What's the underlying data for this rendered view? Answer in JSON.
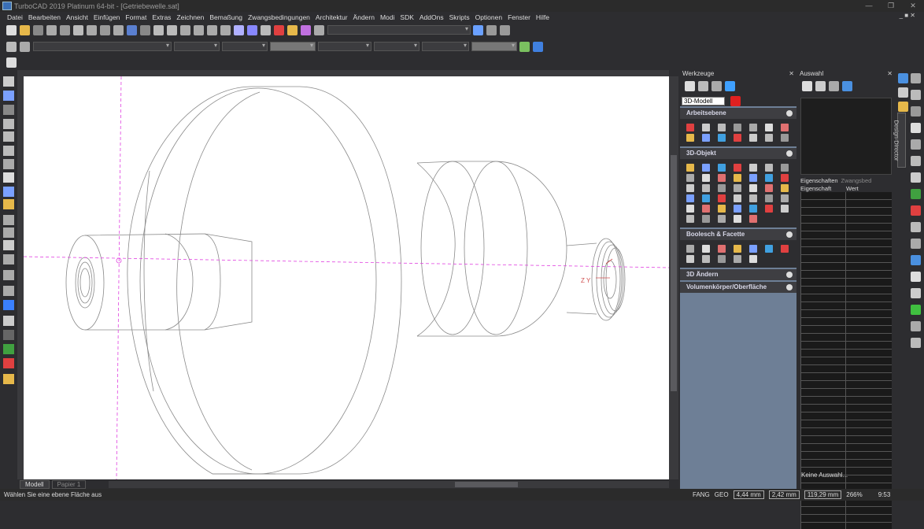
{
  "window": {
    "title": "TurboCAD 2019 Platinum 64-bit - [Getriebewelle.sat]",
    "minimize": "—",
    "restore": "❐",
    "close": "✕",
    "mdi_controls": "_ ■ ✕"
  },
  "menu": [
    "Datei",
    "Bearbeiten",
    "Ansicht",
    "Einfügen",
    "Format",
    "Extras",
    "Zeichnen",
    "Bemaßung",
    "Zwangsbedingungen",
    "Architektur",
    "Ändern",
    "Modi",
    "SDK",
    "AddOns",
    "Skripts",
    "Optionen",
    "Fenster",
    "Hilfe"
  ],
  "viewport": {
    "axis_label": "Z Y"
  },
  "tabs": {
    "model": "Modell",
    "paper": "Papier 1"
  },
  "status": {
    "message": "Wählen Sie eine ebene Fläche aus",
    "snap1": "FANG",
    "snap2": "GEO",
    "field1": "4,44 mm",
    "field2": "2,42 mm",
    "field3": "119,29 mm",
    "zoom": "266%",
    "time": "9:53"
  },
  "werkzeuge": {
    "title": "Werkzeuge",
    "mode_select": "3D-Modell",
    "sections": [
      {
        "label": "Arbeitsebene",
        "icons": 14
      },
      {
        "label": "3D-Objekt",
        "icons": 40
      },
      {
        "label": "Boolesch & Facette",
        "icons": 12
      },
      {
        "label": "3D Ändern",
        "icons": 0
      },
      {
        "label": "Volumenkörper/Oberfläche",
        "icons": 0
      }
    ]
  },
  "auswahl": {
    "title": "Auswahl",
    "tab_properties": "Eigenschaften",
    "tab_constraints": "Zwangsbed",
    "col_property": "Eigenschaft",
    "col_value": "Wert",
    "empty_text": "Keine Auswahl..."
  },
  "design_director": "Design-Director",
  "colors": {
    "accent_magenta": "#e040e0",
    "panel_blue": "#6e7f96"
  }
}
